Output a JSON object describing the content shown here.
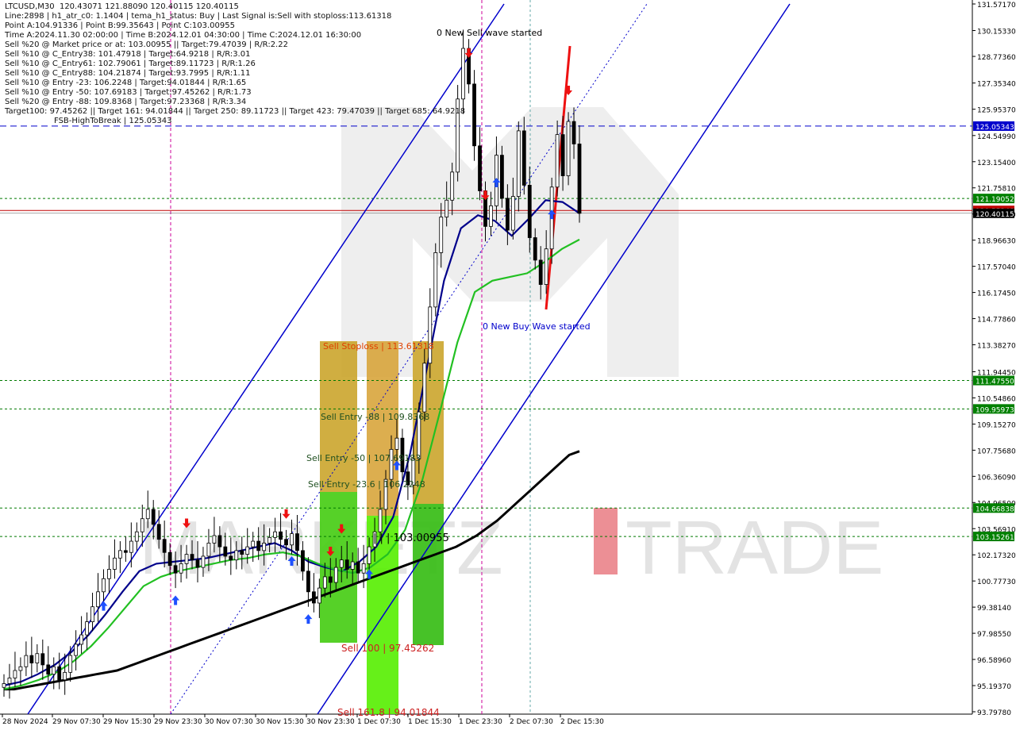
{
  "header": {
    "lines": [
      "LTCUSD,M30  120.43071 121.88090 120.40115 120.40115",
      "Line:2898 | h1_atr_c0: 1.1404 | tema_h1_status: Buy | Last Signal is:Sell with stoploss:113.61318",
      "Point A:104.91336 | Point B:99.35643 | Point C:103.00955",
      "Time A:2024.11.30 02:00:00 | Time B:2024.12.01 04:30:00 | Time C:2024.12.01 16:30:00",
      "Sell %20 @ Market price or at: 103.00955 || Target:79.47039 | R/R:2.22",
      "Sell %10 @ C_Entry38: 101.47918 | Target:64.9218 | R/R:3.01",
      "Sell %10 @ C_Entry61: 102.79061 | Target:89.11723 | R/R:1.26",
      "Sell %10 @ C_Entry88: 104.21874 | Target:93.7995 | R/R:1.11",
      "Sell %10 @ Entry -23: 106.2248 | Target:94.01844 | R/R:1.65",
      "Sell %10 @ Entry -50: 107.69183 | Target:97.45262 | R/R:1.73",
      "Sell %20 @ Entry -88: 109.8368 | Target:97.23368 | R/R:3.34",
      "Target100: 97.45262 || Target 161: 94.01844 || Target 250: 89.11723 || Target 423: 79.47039 || Target 685: 64.9218",
      "FSB-HighToBreak | 125.05343"
    ]
  },
  "watermark": {
    "text_left": "MARKETZ",
    "text_right": "TRADE",
    "accent_color": "#d9202c"
  },
  "colors": {
    "price_line": "#c00000",
    "grid_green": "#007a00",
    "blue_level": "#0000cc",
    "orange_label": "#e06000",
    "ma_black": "#000000",
    "ma_navy": "#00008b",
    "ma_green": "#22c022",
    "arrow_up": "#1e50ff",
    "arrow_down": "#ee1111"
  },
  "y_axis": {
    "min": 93.7978,
    "max": 131.5717,
    "ticks": [
      "131.57170",
      "130.15330",
      "128.77360",
      "127.35340",
      "125.95370",
      "124.54990",
      "123.15400",
      "121.75810",
      "120.36220",
      "118.96630",
      "117.57040",
      "116.17450",
      "114.77860",
      "113.38270",
      "111.94450",
      "110.54860",
      "109.15270",
      "107.75680",
      "106.36090",
      "104.96500",
      "103.56910",
      "102.17320",
      "100.77730",
      "99.38140",
      "97.98550",
      "96.58960",
      "95.19370",
      "93.79780"
    ]
  },
  "levels": [
    {
      "value": "125.05343",
      "price": 125.05343,
      "style": "blue_dashed",
      "tag_bg": "#0000cc"
    },
    {
      "value": "121.19052",
      "price": 121.19052,
      "style": "green_dotted",
      "tag_bg": "#008000"
    },
    {
      "value": "120.55248",
      "price": 120.55248,
      "style": "red_solid",
      "tag_bg": "#c00000"
    },
    {
      "value": "120.40115",
      "price": 120.40115,
      "style": "price_dark",
      "tag_bg": "#000000"
    },
    {
      "value": "111.47550",
      "price": 111.4755,
      "style": "green_dotted",
      "tag_bg": "#008000"
    },
    {
      "value": "109.95973",
      "price": 109.95973,
      "style": "green_dotted",
      "tag_bg": "#008000"
    },
    {
      "value": "104.66838",
      "price": 104.66838,
      "style": "green_dotted",
      "tag_bg": "#008000"
    },
    {
      "value": "103.15261",
      "price": 103.15261,
      "style": "green_dotted",
      "tag_bg": "#008000"
    }
  ],
  "x_axis": {
    "labels": [
      "28 Nov 2024",
      "29 Nov 07:30",
      "29 Nov 15:30",
      "29 Nov 23:30",
      "30 Nov 07:30",
      "30 Nov 15:30",
      "30 Nov 23:30",
      "1 Dec 07:30",
      "1 Dec 15:30",
      "1 Dec 23:30",
      "2 Dec 07:30",
      "2 Dec 15:30"
    ]
  },
  "chart_annotations": {
    "new_sell_wave": "0 New Sell wave started",
    "new_buy_wave": "0 New Buy Wave started",
    "sell_stoploss": "Sell Stoploss | 113.61318",
    "sell_entry_88": "Sell Entry -88 | 109.8368",
    "sell_entry_50": "Sell Entry -50 | 107.69183",
    "sell_entry_23": "Sell Entry -23.6 | 106.2248",
    "point_c": "| | | 103.00955",
    "sell_100": "Sell 100 | 97.45262",
    "sell_161": "Sell 161.8 | 94.01844"
  },
  "chart_data": {
    "type": "candlestick",
    "symbol": "LTCUSD",
    "timeframe": "M30",
    "last_price": 120.40115,
    "ylim": [
      93.7978,
      131.5717
    ],
    "close": [
      95.3,
      95.6,
      96.0,
      96.2,
      96.8,
      96.4,
      96.9,
      96.3,
      95.8,
      96.2,
      95.5,
      95.9,
      96.8,
      97.4,
      97.9,
      98.6,
      99.4,
      100.2,
      100.9,
      101.4,
      102.0,
      102.4,
      102.3,
      102.9,
      103.4,
      104.1,
      104.6,
      103.8,
      103.0,
      102.3,
      101.6,
      101.2,
      101.7,
      102.2,
      101.9,
      101.5,
      102.1,
      102.8,
      103.2,
      102.6,
      102.1,
      101.9,
      102.4,
      102.2,
      102.6,
      102.9,
      102.4,
      102.8,
      103.1,
      103.4,
      103.0,
      102.7,
      103.3,
      102.4,
      101.3,
      100.2,
      99.6,
      100.4,
      101.0,
      100.7,
      101.5,
      101.9,
      101.4,
      101.8,
      101.2,
      101.7,
      102.6,
      103.4,
      104.6,
      106.2,
      107.8,
      108.4,
      106.6,
      105.9,
      107.3,
      109.8,
      112.4,
      115.4,
      118.3,
      120.2,
      121.1,
      122.6,
      126.5,
      129.2,
      127.3,
      124.0,
      121.6,
      119.7,
      120.8,
      123.5,
      121.2,
      119.5,
      121.3,
      124.8,
      121.9,
      119.1,
      117.9,
      116.6,
      118.5,
      121.8,
      124.6,
      122.4,
      125.3,
      124.1,
      120.4
    ],
    "series": [
      {
        "name": "MA black",
        "values": [
          95.0,
          95.0,
          95.1,
          95.2,
          95.3,
          95.4,
          95.5,
          95.6,
          95.7,
          95.8,
          95.9,
          96.0,
          96.2,
          96.4,
          96.6,
          96.8,
          97.0,
          97.2,
          97.4,
          97.6,
          97.8,
          98.0,
          98.2,
          98.4,
          98.6,
          98.8,
          99.0,
          99.2,
          99.4,
          99.6,
          99.8,
          100.0,
          100.2,
          100.4,
          100.6,
          100.8,
          101.0,
          101.2,
          101.4,
          101.6,
          101.8,
          102.0,
          102.2,
          102.4,
          102.6,
          102.9,
          103.2,
          103.6,
          104.0,
          104.5,
          105.0,
          105.5,
          106.0,
          106.5,
          107.0,
          107.5,
          107.7
        ]
      },
      {
        "name": "MA navy",
        "values": [
          95.2,
          95.4,
          95.8,
          96.3,
          97.0,
          97.9,
          99.0,
          100.2,
          101.3,
          101.7,
          101.8,
          101.9,
          102.0,
          102.2,
          102.4,
          102.6,
          102.8,
          102.4,
          101.8,
          101.5,
          101.3,
          101.8,
          102.6,
          104.2,
          107.6,
          112.2,
          116.8,
          119.6,
          120.3,
          120.0,
          119.2,
          120.1,
          121.1,
          121.0,
          120.4
        ]
      },
      {
        "name": "MA green",
        "values": [
          95.0,
          95.2,
          95.5,
          95.9,
          96.5,
          97.3,
          98.3,
          99.4,
          100.5,
          101.0,
          101.3,
          101.5,
          101.7,
          101.9,
          102.0,
          102.2,
          102.3,
          102.1,
          101.7,
          101.4,
          101.2,
          101.5,
          102.2,
          103.5,
          106.2,
          109.8,
          113.5,
          116.2,
          116.8,
          117.0,
          117.2,
          117.8,
          118.5,
          119.0
        ]
      }
    ]
  }
}
